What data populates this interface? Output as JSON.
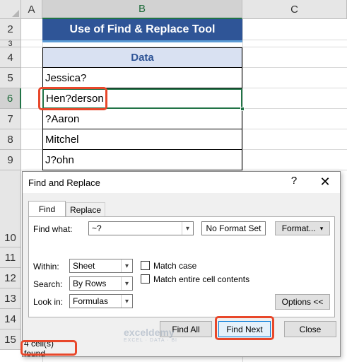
{
  "sheet": {
    "columns": [
      "A",
      "B",
      "C"
    ],
    "active_column": "B",
    "rows": [
      "2",
      "3",
      "4",
      "5",
      "6",
      "7",
      "8",
      "9",
      "10",
      "11",
      "12",
      "13",
      "14",
      "15"
    ],
    "active_row": "6",
    "title": "Use of Find & Replace Tool",
    "data_header": "Data",
    "data": [
      "Jessica?",
      "Hen?derson",
      "?Aaron",
      "Mitchel",
      "J?ohn"
    ]
  },
  "dialog": {
    "title": "Find and Replace",
    "help": "?",
    "close": "✕",
    "tabs": [
      "Find",
      "Replace"
    ],
    "active_tab": "Find",
    "find_what_label": "Find what:",
    "find_what_value": "~?",
    "format_status": "No Format Set",
    "format_button": "Format...",
    "within_label": "Within:",
    "within_value": "Sheet",
    "search_label": "Search:",
    "search_value": "By Rows",
    "lookin_label": "Look in:",
    "lookin_value": "Formulas",
    "match_case": "Match case",
    "match_entire": "Match entire cell contents",
    "options_button": "Options <<",
    "find_all": "Find All",
    "find_next": "Find Next",
    "close_button": "Close",
    "status": "4 cell(s) found"
  },
  "watermark": {
    "brand": "exceldemy",
    "tagline": "EXCEL · DATA · BI"
  },
  "colors": {
    "title_fill": "#2f5597",
    "header_fill": "#d9e1f2",
    "highlight": "#e8472a",
    "selection": "#217346"
  }
}
